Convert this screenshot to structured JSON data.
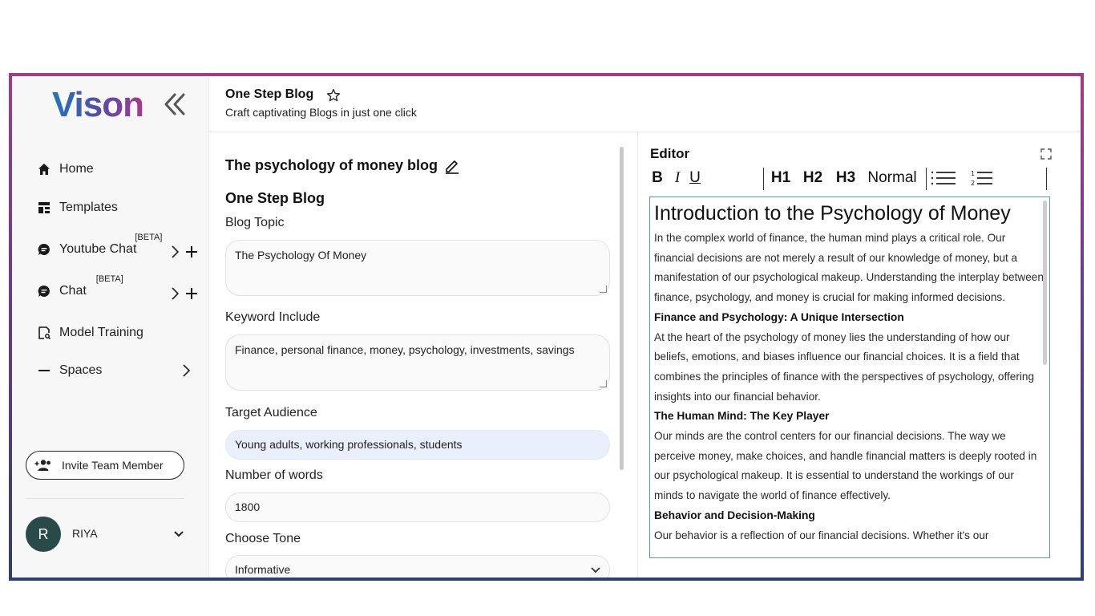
{
  "brand": {
    "logo_text": "Vison"
  },
  "sidebar": {
    "items": [
      {
        "label": "Home",
        "icon": "home-icon"
      },
      {
        "label": "Templates",
        "icon": "templates-icon"
      },
      {
        "label": "Youtube Chat",
        "badge": "[BETA]",
        "icon": "chat-icon"
      },
      {
        "label": "Chat",
        "badge": "[BETA]",
        "icon": "chat-icon"
      },
      {
        "label": "Model Training",
        "icon": "model-training-icon"
      },
      {
        "label": "Spaces",
        "icon": "minus-icon"
      }
    ],
    "invite_label": "Invite Team Member",
    "user": {
      "initial": "R",
      "name": "RIYA"
    }
  },
  "header": {
    "title": "One Step Blog",
    "subtitle": "Craft captivating Blogs in just one click"
  },
  "form": {
    "blog_title": "The psychology of money blog",
    "heading": "One Step Blog",
    "blog_topic": {
      "label": "Blog Topic",
      "value": "The Psychology Of Money"
    },
    "keywords": {
      "label": "Keyword Include",
      "value": "Finance, personal finance, money, psychology, investments, savings"
    },
    "audience": {
      "label": "Target Audience",
      "value": "Young adults, working professionals, students"
    },
    "words": {
      "label": "Number of words",
      "value": "1800"
    },
    "tone": {
      "label": "Choose Tone",
      "value": "Informative"
    }
  },
  "editor": {
    "label": "Editor",
    "toolbar": {
      "bold": "B",
      "italic": "I",
      "underline": "U",
      "h1": "H1",
      "h2": "H2",
      "h3": "H3",
      "normal": "Normal"
    },
    "content": {
      "title": "Introduction to the Psychology of Money",
      "p1": "In the complex world of finance, the human mind plays a critical role. Our financial decisions are not merely a result of our knowledge of money, but a manifestation of our psychological makeup. Understanding the interplay between finance, psychology, and money is crucial for making informed decisions.",
      "h_finance": "Finance and Psychology: A Unique Intersection",
      "p2": "At the heart of the psychology of money lies the understanding of how our beliefs, emotions, and biases influence our financial choices. It is a field that combines the principles of finance with the perspectives of psychology, offering insights into our financial behavior.",
      "h_mind": "The Human Mind: The Key Player",
      "p3": "Our minds are the control centers for our financial decisions. The way we perceive money, make choices, and handle financial matters is deeply rooted in our psychological makeup. It is essential to understand the workings of our minds to navigate the world of finance effectively.",
      "h_behavior": "Behavior and Decision-Making",
      "p4": "Our behavior is a reflection of our financial decisions. Whether it's our"
    }
  },
  "colors": {
    "brand_gradient_start": "#1f76b8",
    "brand_gradient_end": "#a6398c",
    "frame_top": "#a43a8c",
    "frame_bottom": "#2e3f72",
    "highlight_field": "#e9f0fb"
  }
}
